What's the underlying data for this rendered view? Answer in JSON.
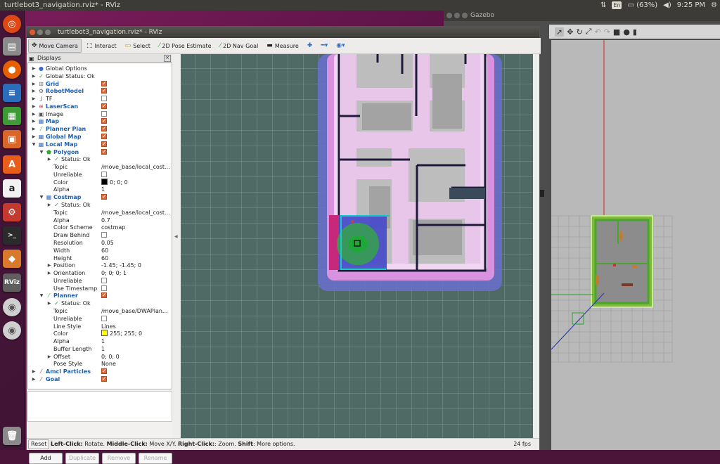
{
  "topbar": {
    "title": "turtlebot3_navigation.rviz* - RViz",
    "lang": "En",
    "battery": "(63%)",
    "time": "9:25 PM"
  },
  "gazebo": {
    "title": "Gazebo"
  },
  "rviz": {
    "title": "turtlebot3_navigation.rviz* - RViz",
    "toolbar": {
      "move_camera": "Move Camera",
      "interact": "Interact",
      "select": "Select",
      "pose_estimate": "2D Pose Estimate",
      "nav_goal": "2D Nav Goal",
      "measure": "Measure"
    },
    "panel": {
      "title": "Displays",
      "buttons": {
        "add": "Add",
        "duplicate": "Duplicate",
        "remove": "Remove",
        "rename": "Rename"
      }
    },
    "tree": [
      {
        "level": 0,
        "label": "Global Options",
        "icon": "globe-icon",
        "arrow": "right",
        "blue": false
      },
      {
        "level": 0,
        "label": "Global Status: Ok",
        "icon": "check-icon",
        "arrow": "right",
        "blue": false
      },
      {
        "level": 0,
        "label": "Grid",
        "icon": "grid-icon",
        "arrow": "right",
        "blue": true,
        "checked": true
      },
      {
        "level": 0,
        "label": "RobotModel",
        "icon": "robot-icon",
        "arrow": "right",
        "blue": true,
        "checked": true
      },
      {
        "level": 0,
        "label": "TF",
        "icon": "tf-icon",
        "arrow": "right",
        "blue": false,
        "checked": false
      },
      {
        "level": 0,
        "label": "LaserScan",
        "icon": "laser-icon",
        "arrow": "right",
        "blue": true,
        "checked": true
      },
      {
        "level": 0,
        "label": "Image",
        "icon": "image-icon",
        "arrow": "right",
        "blue": false,
        "checked": false
      },
      {
        "level": 0,
        "label": "Map",
        "icon": "map-icon",
        "arrow": "right",
        "blue": true,
        "checked": true
      },
      {
        "level": 0,
        "label": "Planner Plan",
        "icon": "path-icon",
        "arrow": "right",
        "blue": true,
        "checked": true
      },
      {
        "level": 0,
        "label": "Global Map",
        "icon": "folder-icon",
        "arrow": "right",
        "blue": true,
        "checked": true
      },
      {
        "level": 0,
        "label": "Local Map",
        "icon": "folder-icon",
        "arrow": "down",
        "blue": true,
        "checked": true
      },
      {
        "level": 1,
        "label": "Polygon",
        "icon": "polygon-icon",
        "arrow": "down",
        "blue": true,
        "checked": true
      },
      {
        "level": 2,
        "label": "Status: Ok",
        "icon": "check-icon",
        "arrow": "right",
        "blue": false
      },
      {
        "level": 2,
        "label": "Topic",
        "value": "/move_base/local_cost..."
      },
      {
        "level": 2,
        "label": "Unreliable",
        "checked": false
      },
      {
        "level": 2,
        "label": "Color",
        "value": "0; 0; 0",
        "swatch": "#000000"
      },
      {
        "level": 2,
        "label": "Alpha",
        "value": "1"
      },
      {
        "level": 1,
        "label": "Costmap",
        "icon": "map-icon",
        "arrow": "down",
        "blue": true,
        "checked": true
      },
      {
        "level": 2,
        "label": "Status: Ok",
        "icon": "check-icon",
        "arrow": "right",
        "blue": false
      },
      {
        "level": 2,
        "label": "Topic",
        "value": "/move_base/local_cost..."
      },
      {
        "level": 2,
        "label": "Alpha",
        "value": "0.7"
      },
      {
        "level": 2,
        "label": "Color Scheme",
        "value": "costmap"
      },
      {
        "level": 2,
        "label": "Draw Behind",
        "checked": false
      },
      {
        "level": 2,
        "label": "Resolution",
        "value": "0.05"
      },
      {
        "level": 2,
        "label": "Width",
        "value": "60"
      },
      {
        "level": 2,
        "label": "Height",
        "value": "60"
      },
      {
        "level": 2,
        "label": "Position",
        "value": "-1.45; -1.45; 0",
        "arrow": "right"
      },
      {
        "level": 2,
        "label": "Orientation",
        "value": "0; 0; 0; 1",
        "arrow": "right"
      },
      {
        "level": 2,
        "label": "Unreliable",
        "checked": false
      },
      {
        "level": 2,
        "label": "Use Timestamp",
        "checked": false
      },
      {
        "level": 1,
        "label": "Planner",
        "icon": "path-icon",
        "arrow": "down",
        "blue": true,
        "checked": true
      },
      {
        "level": 2,
        "label": "Status: Ok",
        "icon": "check-icon",
        "arrow": "right",
        "blue": false
      },
      {
        "level": 2,
        "label": "Topic",
        "value": "/move_base/DWAPlan..."
      },
      {
        "level": 2,
        "label": "Unreliable",
        "checked": false
      },
      {
        "level": 2,
        "label": "Line Style",
        "value": "Lines"
      },
      {
        "level": 2,
        "label": "Color",
        "value": "255; 255; 0",
        "swatch": "#ffff00"
      },
      {
        "level": 2,
        "label": "Alpha",
        "value": "1"
      },
      {
        "level": 2,
        "label": "Buffer Length",
        "value": "1"
      },
      {
        "level": 2,
        "label": "Offset",
        "value": "0; 0; 0",
        "arrow": "right"
      },
      {
        "level": 2,
        "label": "Pose Style",
        "value": "None"
      },
      {
        "level": 0,
        "label": "Amcl Particles",
        "icon": "particles-icon",
        "arrow": "right",
        "blue": true,
        "checked": true
      },
      {
        "level": 0,
        "label": "Goal",
        "icon": "arrow-icon",
        "arrow": "right",
        "blue": true,
        "checked": true
      }
    ],
    "status": {
      "reset": "Reset",
      "help_bold1": "Left-Click:",
      "help1": " Rotate. ",
      "help_bold2": "Middle-Click:",
      "help2": " Move X/Y. ",
      "help_bold3": "Right-Click:",
      "help3": ": Zoom. ",
      "help_bold4": "Shift",
      "help4": ": More options.",
      "fps": "24 fps"
    }
  },
  "colors": {
    "accent_check": "#e06b3a",
    "link_blue": "#1a5fb4",
    "grid_bg": "#4f6a65"
  }
}
